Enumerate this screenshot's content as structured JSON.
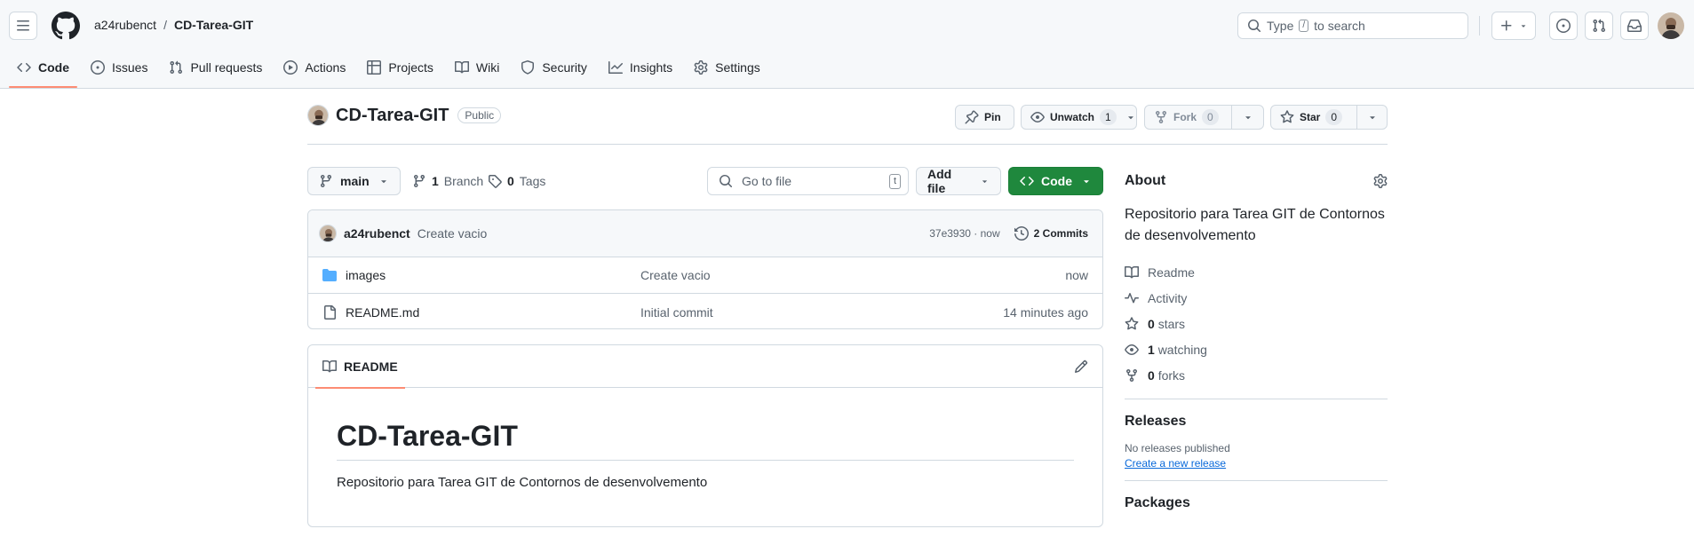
{
  "header": {
    "owner": "a24rubenct",
    "separator": "/",
    "repo": "CD-Tarea-GIT",
    "search_prefix": "Type",
    "search_key": "/",
    "search_suffix": "to search"
  },
  "tabs": [
    {
      "label": "Code",
      "icon": "code-icon"
    },
    {
      "label": "Issues",
      "icon": "issue-icon"
    },
    {
      "label": "Pull requests",
      "icon": "pull-request-icon"
    },
    {
      "label": "Actions",
      "icon": "play-icon"
    },
    {
      "label": "Projects",
      "icon": "table-icon"
    },
    {
      "label": "Wiki",
      "icon": "book-icon"
    },
    {
      "label": "Security",
      "icon": "shield-icon"
    },
    {
      "label": "Insights",
      "icon": "graph-icon"
    },
    {
      "label": "Settings",
      "icon": "gear-icon"
    }
  ],
  "repo": {
    "title": "CD-Tarea-GIT",
    "visibility": "Public",
    "pin_label": "Pin",
    "unwatch_label": "Unwatch",
    "watch_count": "1",
    "fork_label": "Fork",
    "fork_count": "0",
    "star_label": "Star",
    "star_count": "0"
  },
  "toolbar": {
    "branch": "main",
    "branch_count": "1",
    "branch_label": "Branch",
    "tag_count": "0",
    "tag_label": "Tags",
    "goto_placeholder": "Go to file",
    "goto_key": "t",
    "add_file_label": "Add file",
    "code_label": "Code"
  },
  "commit": {
    "author": "a24rubenct",
    "message": "Create vacio",
    "sha_time": "37e3930 · now",
    "commits_label": "2 Commits"
  },
  "files": [
    {
      "name": "images",
      "type": "folder",
      "message": "Create vacio",
      "age": "now"
    },
    {
      "name": "README.md",
      "type": "file",
      "message": "Initial commit",
      "age": "14 minutes ago"
    }
  ],
  "readme": {
    "tab_label": "README",
    "heading": "CD-Tarea-GIT",
    "body": "Repositorio para Tarea GIT de Contornos de desenvolvemento"
  },
  "about": {
    "title": "About",
    "description": "Repositorio para Tarea GIT de Contornos de desenvolvemento",
    "readme_label": "Readme",
    "activity_label": "Activity",
    "stars_count": "0",
    "stars_label": "stars",
    "watching_count": "1",
    "watching_label": "watching",
    "forks_count": "0",
    "forks_label": "forks"
  },
  "releases": {
    "title": "Releases",
    "empty_text": "No releases published",
    "create_link": "Create a new release"
  },
  "packages": {
    "title": "Packages"
  },
  "colors": {
    "accent_green": "#1f883d",
    "tab_underline": "#fd8c73",
    "link_blue": "#0969da",
    "folder_blue": "#54aeff"
  }
}
